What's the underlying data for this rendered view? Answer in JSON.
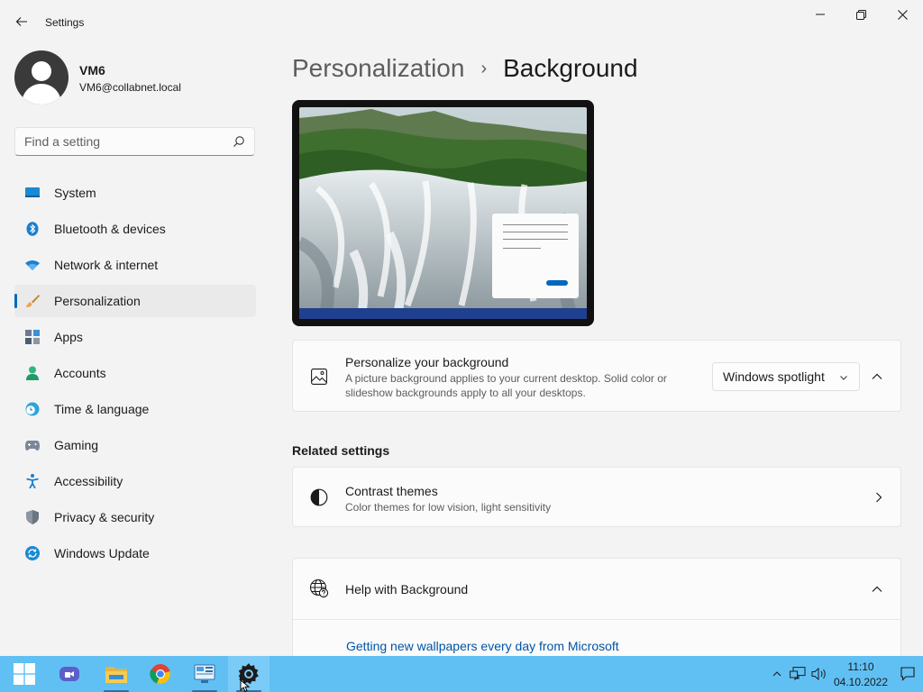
{
  "window": {
    "title": "Settings"
  },
  "profile": {
    "name": "VM6",
    "email": "VM6@collabnet.local"
  },
  "search": {
    "placeholder": "Find a setting",
    "value": ""
  },
  "sidebar": {
    "items": [
      {
        "label": "System",
        "icon": "system-icon"
      },
      {
        "label": "Bluetooth & devices",
        "icon": "bluetooth-icon"
      },
      {
        "label": "Network & internet",
        "icon": "wifi-icon"
      },
      {
        "label": "Personalization",
        "icon": "paintbrush-icon",
        "active": true
      },
      {
        "label": "Apps",
        "icon": "apps-icon"
      },
      {
        "label": "Accounts",
        "icon": "accounts-icon"
      },
      {
        "label": "Time & language",
        "icon": "time-language-icon"
      },
      {
        "label": "Gaming",
        "icon": "gamepad-icon"
      },
      {
        "label": "Accessibility",
        "icon": "accessibility-icon"
      },
      {
        "label": "Privacy & security",
        "icon": "shield-icon"
      },
      {
        "label": "Windows Update",
        "icon": "windows-update-icon"
      }
    ]
  },
  "breadcrumb": {
    "parent": "Personalization",
    "separator": "›",
    "current": "Background"
  },
  "background_setting": {
    "title": "Personalize your background",
    "description_line1": "A picture background applies to your current desktop. Solid color or",
    "description_line2": "slideshow backgrounds apply to all your desktops.",
    "selected": "Windows spotlight"
  },
  "related": {
    "heading": "Related settings",
    "contrast": {
      "title": "Contrast themes",
      "description": "Color themes for low vision, light sensitivity"
    }
  },
  "help": {
    "title": "Help with Background",
    "link": "Getting new wallpapers every day from Microsoft"
  },
  "taskbar": {
    "apps": [
      "start-icon",
      "teams-chat-icon",
      "file-explorer-icon",
      "chrome-icon",
      "control-panel-icon",
      "settings-icon"
    ],
    "active_app": "settings-icon",
    "time": "11:10",
    "date": "04.10.2022"
  },
  "colors": {
    "accent": "#0067c0",
    "taskbar": "#60c0f4",
    "background": "#f3f3f3"
  }
}
